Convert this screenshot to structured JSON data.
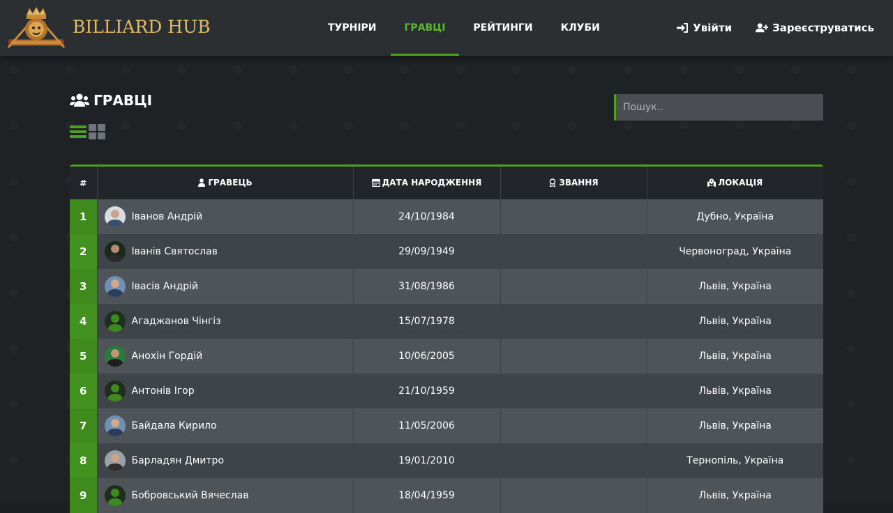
{
  "brand": {
    "name": "BILLIARD HUB"
  },
  "nav": {
    "items": [
      {
        "label": "ТУРНІРИ",
        "active": false
      },
      {
        "label": "ГРАВЦІ",
        "active": true
      },
      {
        "label": "РЕЙТИНГИ",
        "active": false
      },
      {
        "label": "КЛУБИ",
        "active": false
      }
    ]
  },
  "auth": {
    "login_label": "Увійти",
    "register_label": "Зареєструватись"
  },
  "page": {
    "title": "ГРАВЦІ"
  },
  "search": {
    "placeholder": "Пошук.."
  },
  "table": {
    "headers": {
      "num": "#",
      "player": "ГРАВЕЦЬ",
      "birth": "ДАТА НАРОДЖЕННЯ",
      "rank": "ЗВАННЯ",
      "location": "ЛОКАЦІЯ"
    },
    "rows": [
      {
        "num": "1",
        "name": "Іванов Андрій",
        "birth": "24/10/1984",
        "rank": "",
        "location": "Дубно, Україна",
        "avatar": "photo-light"
      },
      {
        "num": "2",
        "name": "Іванів Святослав",
        "birth": "29/09/1949",
        "rank": "",
        "location": "Червоноград, Україна",
        "avatar": "photo-dark"
      },
      {
        "num": "3",
        "name": "Івасів Андрій",
        "birth": "31/08/1986",
        "rank": "",
        "location": "Львів, Україна",
        "avatar": "photo-blue"
      },
      {
        "num": "4",
        "name": "Агаджанов Чінгіз",
        "birth": "15/07/1978",
        "rank": "",
        "location": "Львів, Україна",
        "avatar": "placeholder"
      },
      {
        "num": "5",
        "name": "Анохін Гордій",
        "birth": "10/06/2005",
        "rank": "",
        "location": "Львів, Україна",
        "avatar": "photo-green"
      },
      {
        "num": "6",
        "name": "Антонів Ігор",
        "birth": "21/10/1959",
        "rank": "",
        "location": "Львів, Україна",
        "avatar": "placeholder"
      },
      {
        "num": "7",
        "name": "Байдала Кирило",
        "birth": "11/05/2006",
        "rank": "",
        "location": "Львів, Україна",
        "avatar": "photo-blue"
      },
      {
        "num": "8",
        "name": "Барладян Дмитро",
        "birth": "19/01/2010",
        "rank": "",
        "location": "Тернопіль, Україна",
        "avatar": "photo-grey"
      },
      {
        "num": "9",
        "name": "Бобровський Вячеслав",
        "birth": "18/04/1959",
        "rank": "",
        "location": "Львів, Україна",
        "avatar": "placeholder"
      }
    ]
  },
  "colors": {
    "accent": "#4e9f22",
    "brand_gold": "#e2b96a"
  }
}
